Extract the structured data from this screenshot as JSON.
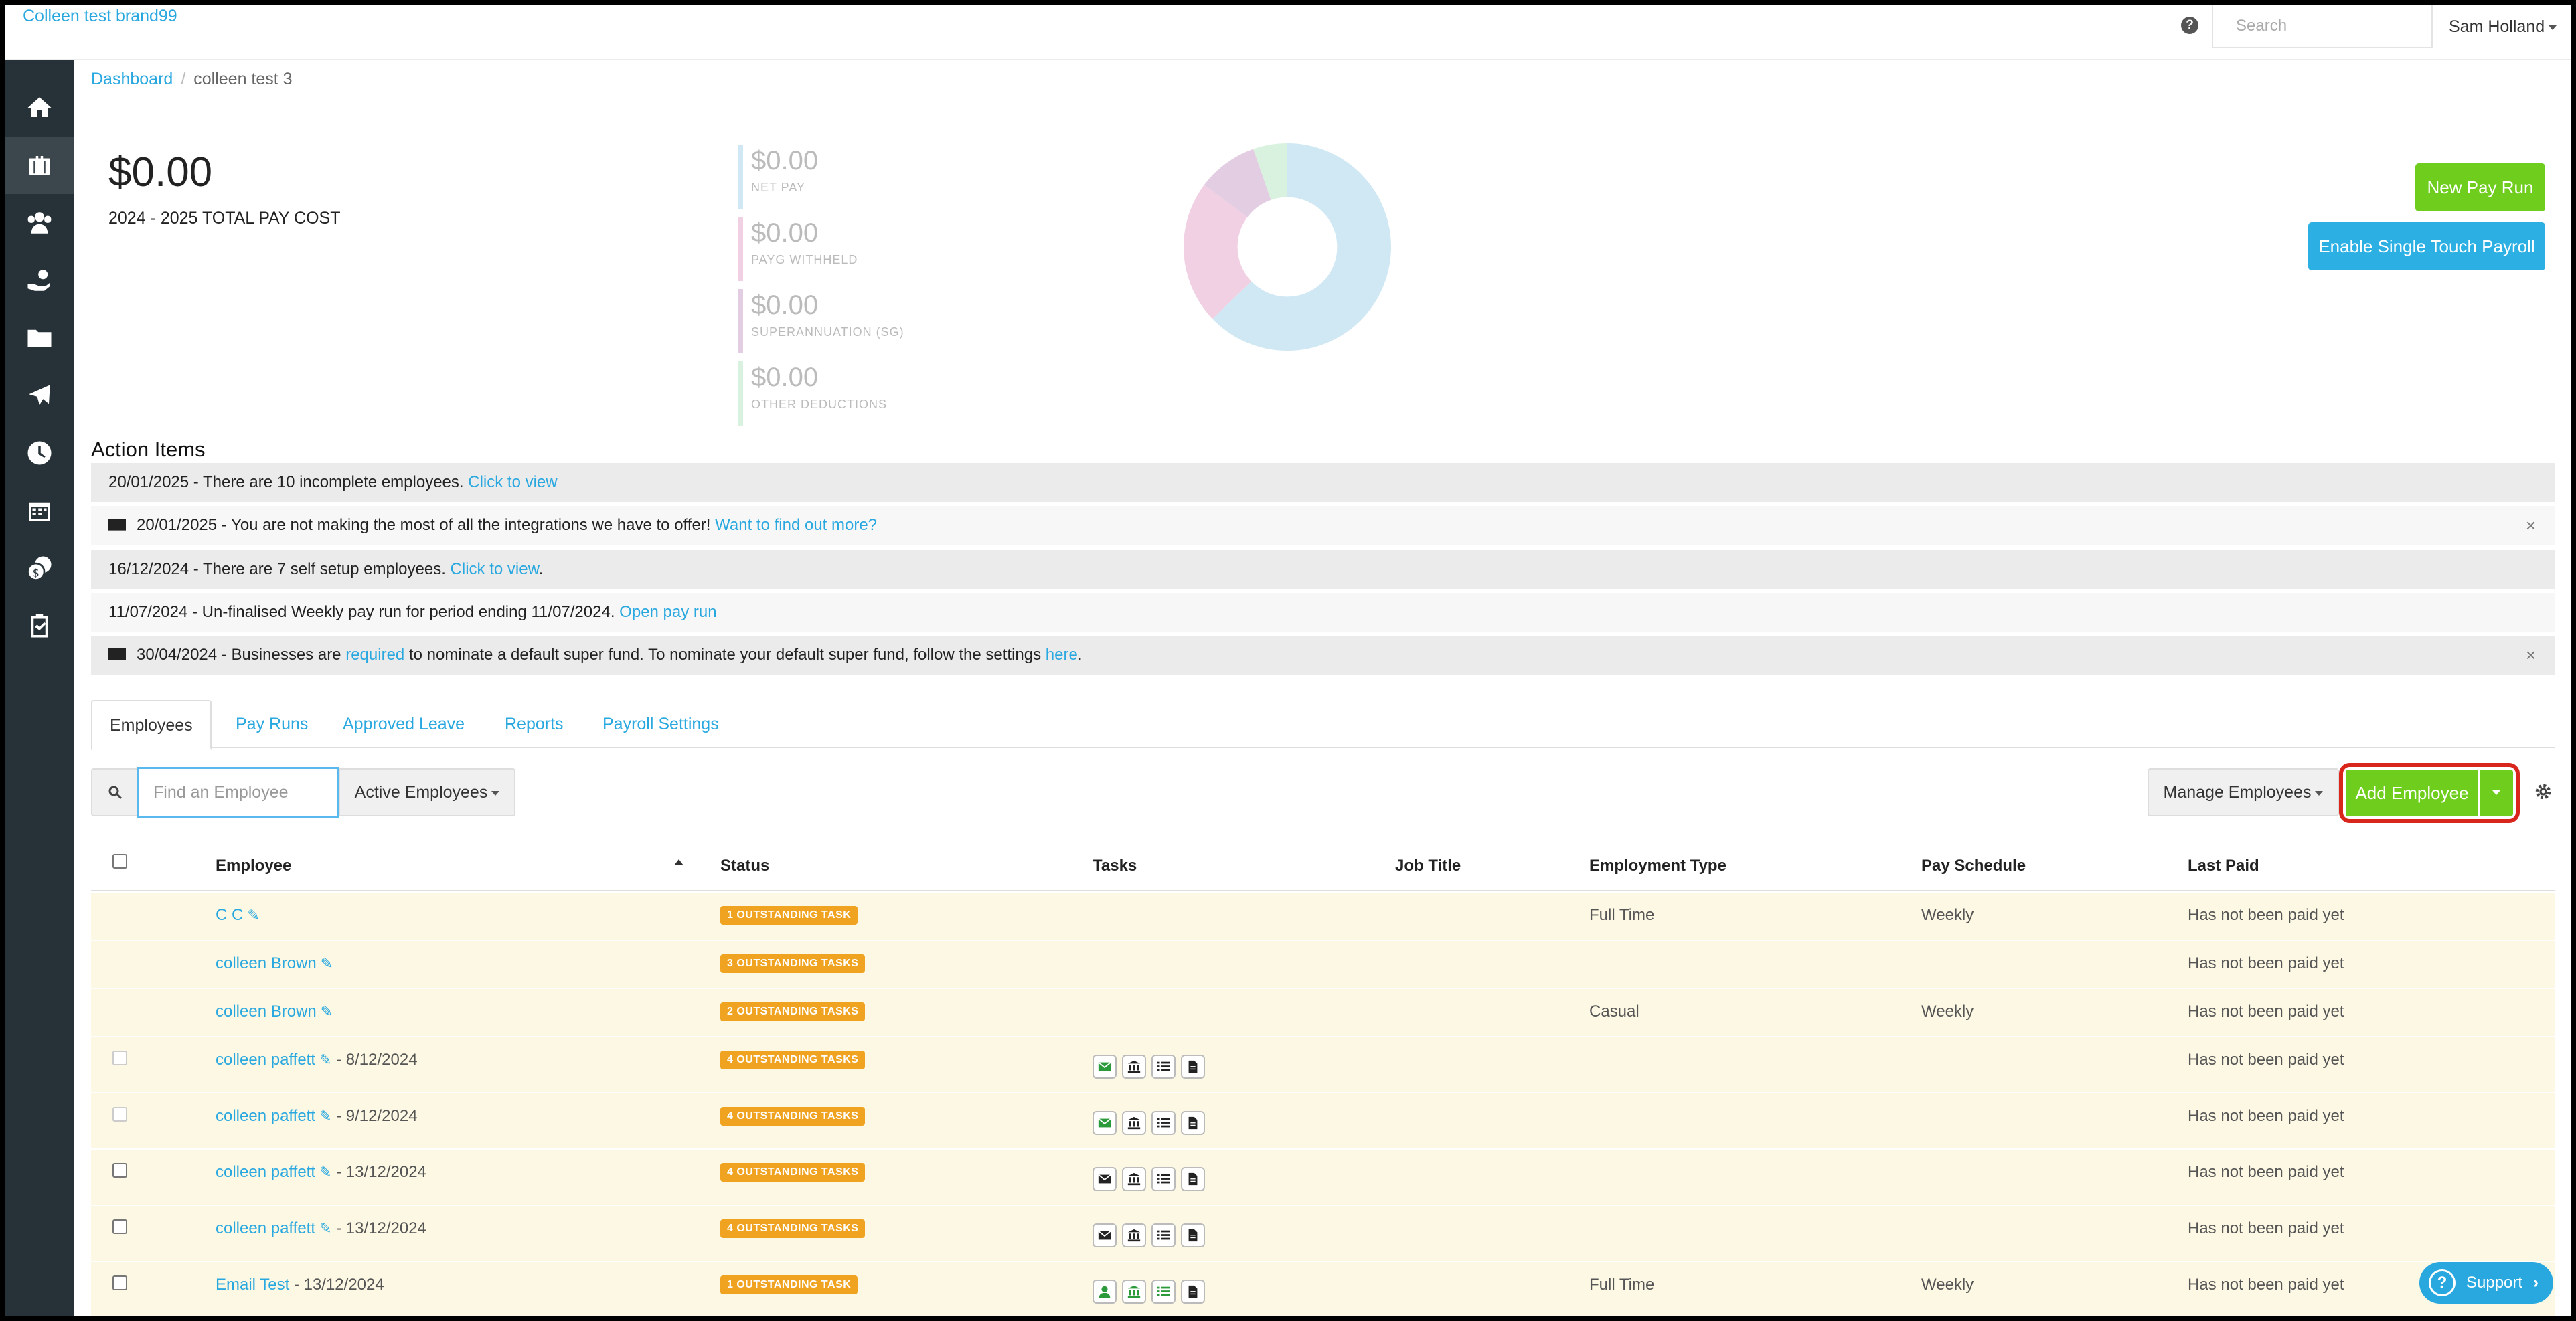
{
  "topbar": {
    "brand": "Colleen test brand99",
    "search_placeholder": "Search",
    "user": "Sam Holland"
  },
  "breadcrumb": {
    "home": "Dashboard",
    "current": "colleen test 3"
  },
  "summary": {
    "total_amount": "$0.00",
    "total_label": "2024 - 2025 TOTAL PAY COST",
    "stats": [
      {
        "amount": "$0.00",
        "label": "NET PAY",
        "color": "#cfe8f3"
      },
      {
        "amount": "$0.00",
        "label": "PAYG WITHHELD",
        "color": "#f1d0e3"
      },
      {
        "amount": "$0.00",
        "label": "SUPERANNUATION (SG)",
        "color": "#e3cde2"
      },
      {
        "amount": "$0.00",
        "label": "OTHER DEDUCTIONS",
        "color": "#d9f2df"
      }
    ]
  },
  "buttons": {
    "new_pay_run": "New Pay Run",
    "enable_stp": "Enable Single Touch Payroll",
    "manage_employees": "Manage Employees",
    "add_employee": "Add Employee",
    "support": "Support"
  },
  "action_items": {
    "title": "Action Items",
    "items": [
      {
        "text": "20/01/2025 - There are 10 incomplete employees. ",
        "link": "Click to view",
        "after": ""
      },
      {
        "text": "20/01/2025 - You are not making the most of all the integrations we have to offer! ",
        "link": "Want to find out more?",
        "after": ""
      },
      {
        "text": "16/12/2024 - There are 7 self setup employees. ",
        "link": "Click to view",
        "after": "."
      },
      {
        "text": "11/07/2024 - Un-finalised Weekly pay run for period ending 11/07/2024. ",
        "link": "Open pay run",
        "after": ""
      },
      {
        "text": "30/04/2024 - Businesses are ",
        "link": "required",
        "mid": " to nominate a default super fund. To nominate your default super fund, follow the settings ",
        "link2": "here",
        "after": "."
      }
    ]
  },
  "tabs": [
    "Employees",
    "Pay Runs",
    "Approved Leave",
    "Reports",
    "Payroll Settings"
  ],
  "filter": {
    "find_placeholder": "Find an Employee",
    "active_filter": "Active Employees"
  },
  "table": {
    "headers": [
      "Employee",
      "Status",
      "Tasks",
      "Job Title",
      "Employment Type",
      "Pay Schedule",
      "Last Paid"
    ],
    "rows": [
      {
        "name": "C C",
        "date": "",
        "status": "1 OUTSTANDING TASK",
        "type": "Full Time",
        "schedule": "Weekly",
        "last_paid": "Has not been paid yet"
      },
      {
        "name": "colleen Brown",
        "date": "",
        "status": "3 OUTSTANDING TASKS",
        "type": "",
        "schedule": "",
        "last_paid": "Has not been paid yet"
      },
      {
        "name": "colleen Brown",
        "date": "",
        "status": "2 OUTSTANDING TASKS",
        "type": "Casual",
        "schedule": "Weekly",
        "last_paid": "Has not been paid yet"
      },
      {
        "name": "colleen paffett",
        "date": "- 8/12/2024",
        "status": "4 OUTSTANDING TASKS",
        "type": "",
        "schedule": "",
        "last_paid": "Has not been paid yet"
      },
      {
        "name": "colleen paffett",
        "date": "- 9/12/2024",
        "status": "4 OUTSTANDING TASKS",
        "type": "",
        "schedule": "",
        "last_paid": "Has not been paid yet"
      },
      {
        "name": "colleen paffett",
        "date": "- 13/12/2024",
        "status": "4 OUTSTANDING TASKS",
        "type": "",
        "schedule": "",
        "last_paid": "Has not been paid yet"
      },
      {
        "name": "colleen paffett",
        "date": "- 13/12/2024",
        "status": "4 OUTSTANDING TASKS",
        "type": "",
        "schedule": "",
        "last_paid": "Has not been paid yet"
      },
      {
        "name": "Email Test",
        "date": "- 13/12/2024",
        "status": "1 OUTSTANDING TASK",
        "type": "Full Time",
        "schedule": "Weekly",
        "last_paid": "Has not been paid yet"
      }
    ]
  },
  "colors": {
    "accent": "#29a8e0",
    "green": "#6fcd1d",
    "warning": "#efa320",
    "sidebar": "#263238"
  }
}
